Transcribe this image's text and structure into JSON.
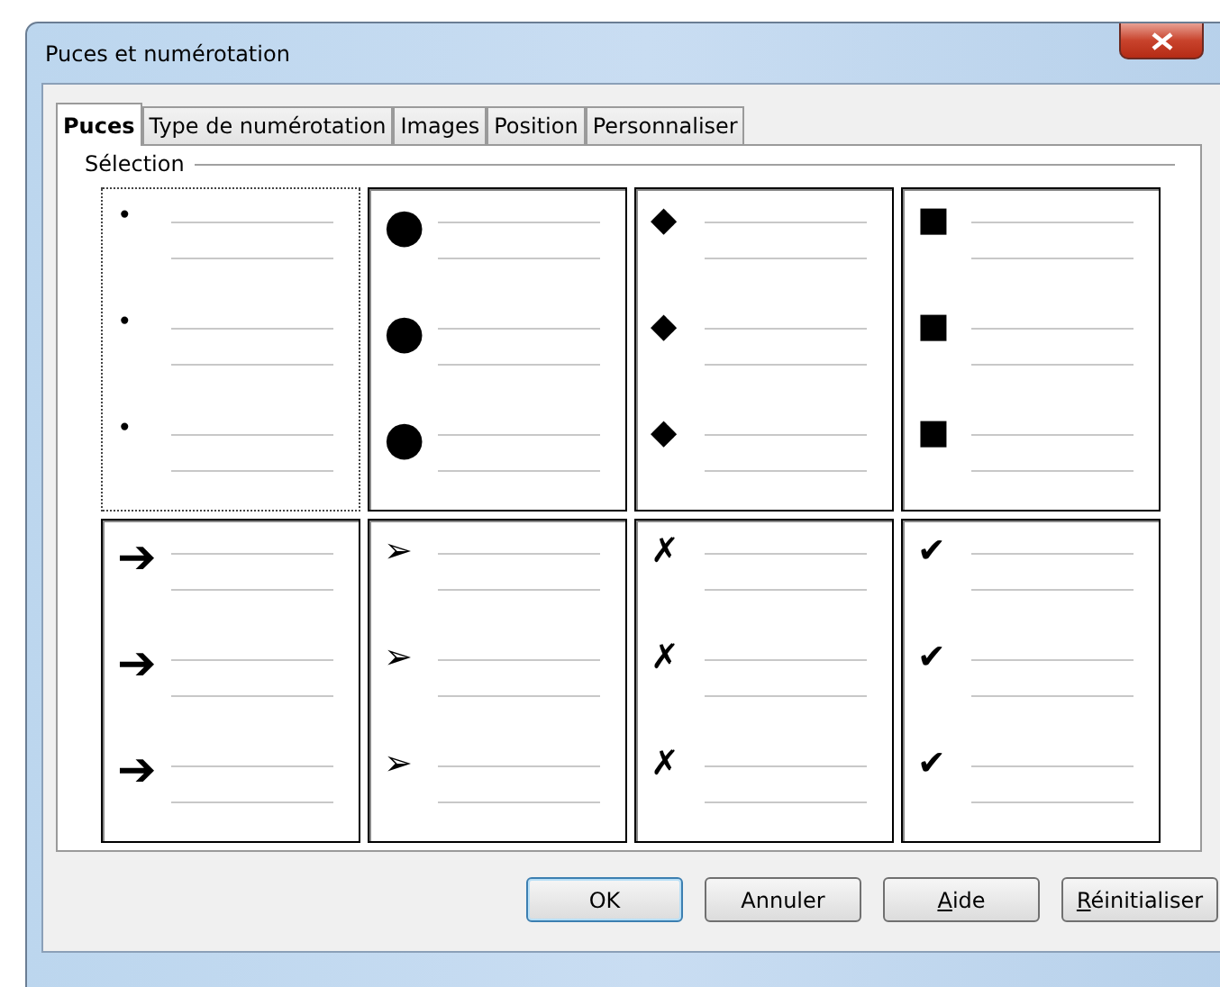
{
  "window": {
    "title": "Puces et numérotation"
  },
  "tabs": [
    {
      "label": "Puces",
      "selected": true
    },
    {
      "label": "Type de numérotation",
      "selected": false
    },
    {
      "label": "Images",
      "selected": false
    },
    {
      "label": "Position",
      "selected": false
    },
    {
      "label": "Personnaliser",
      "selected": false
    }
  ],
  "section": {
    "title": "Sélection"
  },
  "styles": [
    {
      "bullets": [
        "•",
        "•",
        "•"
      ],
      "kind": "small",
      "selected": true
    },
    {
      "bullets": [
        "●",
        "●",
        "●"
      ],
      "kind": "large",
      "selected": false
    },
    {
      "bullets": [
        "◆",
        "◆",
        "◆"
      ],
      "kind": "medium",
      "selected": false
    },
    {
      "bullets": [
        "■",
        "■",
        "■"
      ],
      "kind": "medium",
      "selected": false
    },
    {
      "bullets": [
        "➔",
        "➔",
        "➔"
      ],
      "kind": "large",
      "selected": false
    },
    {
      "bullets": [
        "➢",
        "➢",
        "➢"
      ],
      "kind": "medium",
      "selected": false
    },
    {
      "bullets": [
        "✗",
        "✗",
        "✗"
      ],
      "kind": "medium",
      "selected": false
    },
    {
      "bullets": [
        "✔",
        "✔",
        "✔"
      ],
      "kind": "medium",
      "selected": false
    }
  ],
  "buttons": [
    {
      "label": "OK",
      "default": true,
      "mnemonic": false
    },
    {
      "label": "Annuler",
      "default": false,
      "mnemonic": false
    },
    {
      "label": "Aide",
      "default": false,
      "mnemonic": true
    },
    {
      "label": "Réinitialiser",
      "default": false,
      "mnemonic": true
    }
  ]
}
